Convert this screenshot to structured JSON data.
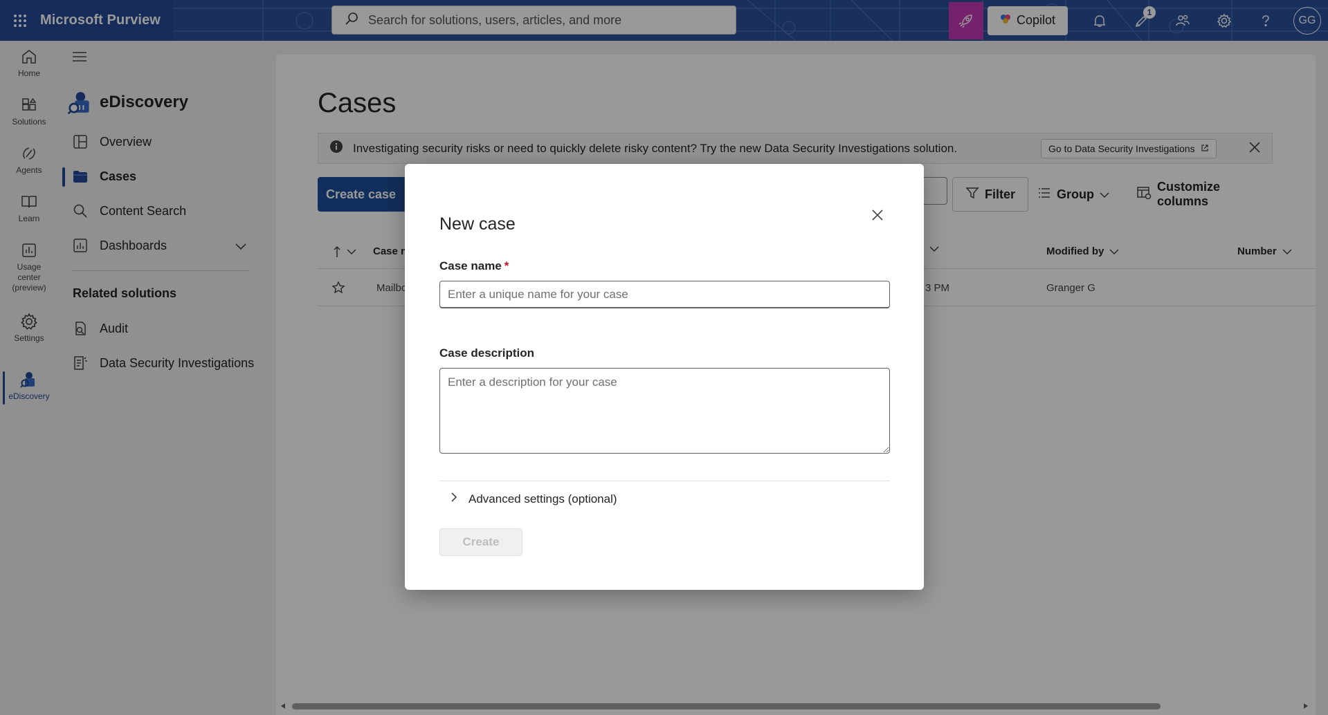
{
  "topbar": {
    "brand": "Microsoft Purview",
    "search_placeholder": "Search for solutions, users, articles, and more",
    "copilot_label": "Copilot",
    "notification_count": "1",
    "avatar_initials": "GG",
    "icons": [
      "waffle-icon",
      "search-icon",
      "rocket-icon",
      "copilot-icon",
      "bell-icon",
      "announcement-icon",
      "people-icon",
      "gear-icon",
      "help-icon"
    ]
  },
  "rail": {
    "items": [
      {
        "label": "Home",
        "icon": "home-icon"
      },
      {
        "label": "Solutions",
        "icon": "solutions-icon"
      },
      {
        "label": "Agents",
        "icon": "agents-icon"
      },
      {
        "label": "Learn",
        "icon": "book-icon"
      },
      {
        "label": "Usage center (preview)",
        "icon": "usage-icon"
      },
      {
        "label": "Settings",
        "icon": "gear-icon"
      },
      {
        "label": "eDiscovery",
        "icon": "ediscovery-icon"
      }
    ]
  },
  "nav": {
    "title": "eDiscovery",
    "items": [
      {
        "label": "Overview"
      },
      {
        "label": "Cases"
      },
      {
        "label": "Content Search"
      },
      {
        "label": "Dashboards"
      }
    ],
    "related_heading": "Related solutions",
    "related": [
      {
        "label": "Audit"
      },
      {
        "label": "Data Security Investigations"
      }
    ]
  },
  "main": {
    "title": "Cases",
    "banner_text": "Investigating security risks or need to quickly delete risky content? Try the new Data Security Investigations solution.",
    "banner_button": "Go to Data Security Investigations",
    "create_case": "Create case",
    "filter": "Filter",
    "group": "Group",
    "customize_columns": "Customize columns",
    "columns": [
      "Case na",
      "Modified by",
      "Number"
    ],
    "row": {
      "name": "Mailbo",
      "modified_time": "3 PM",
      "modified_by": "Granger G"
    }
  },
  "dialog": {
    "title": "New case",
    "case_name_label": "Case name",
    "required_mark": "*",
    "case_name_placeholder": "Enter a unique name for your case",
    "case_description_label": "Case description",
    "case_description_placeholder": "Enter a description for your case",
    "advanced_label": "Advanced settings (optional)",
    "create_label": "Create"
  },
  "colors": {
    "brand_blue": "#244a96",
    "primary_button": "#1f4e99",
    "rocket_magenta": "#c239b3",
    "required_red": "#c50f1f"
  }
}
